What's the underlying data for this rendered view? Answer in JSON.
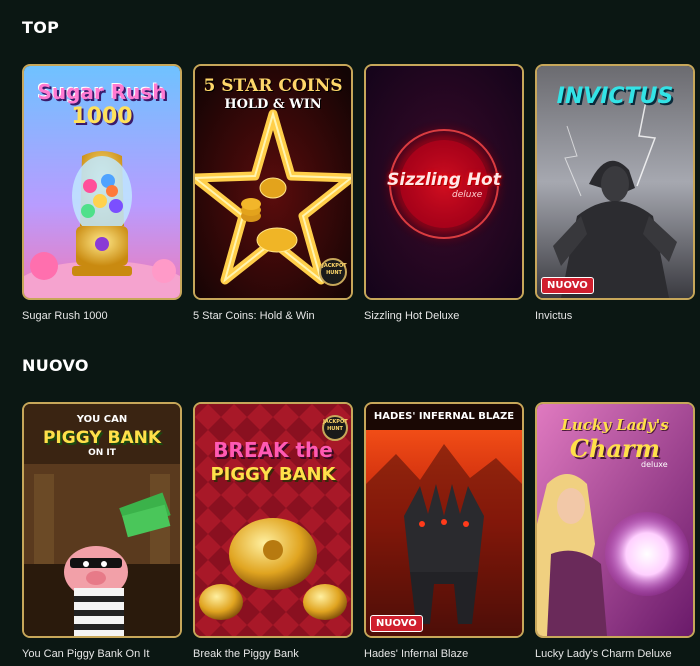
{
  "sections": [
    {
      "title": "TOP",
      "games": [
        {
          "label": "Sugar Rush 1000",
          "art_title": "Sugar Rush",
          "art_subtitle": "1000",
          "badge": ""
        },
        {
          "label": "5 Star Coins: Hold & Win",
          "art_title": "5 STAR COINS",
          "art_subtitle": "HOLD & WIN",
          "provider_mark": "JACKPOT HUNT",
          "badge": ""
        },
        {
          "label": "Sizzling Hot Deluxe",
          "art_title": "Sizzling Hot",
          "art_subtitle": "deluxe",
          "badge": ""
        },
        {
          "label": "Invictus",
          "art_title": "INVICTUS",
          "badge": "NUOVO"
        }
      ]
    },
    {
      "title": "NUOVO",
      "games": [
        {
          "label": "You Can Piggy Bank On It",
          "art_pre": "YOU CAN",
          "art_title": "PIGGY BANK",
          "art_subtitle": "ON IT",
          "badge": ""
        },
        {
          "label": "Break the Piggy Bank",
          "art_title": "BREAK the",
          "art_subtitle": "PIGGY BANK",
          "provider_mark": "JACKPOT HUNT",
          "badge": ""
        },
        {
          "label": "Hades' Infernal Blaze",
          "art_title": "HADES' INFERNAL BLAZE",
          "badge": "NUOVO"
        },
        {
          "label": "Lucky Lady's Charm Deluxe",
          "art_title": "Lucky Lady's",
          "art_subtitle": "Charm",
          "art_tag": "deluxe",
          "badge": ""
        }
      ]
    }
  ],
  "colors": {
    "background": "#0b1713",
    "tile_border": "#c7a75a",
    "badge": "#d01f2e"
  }
}
